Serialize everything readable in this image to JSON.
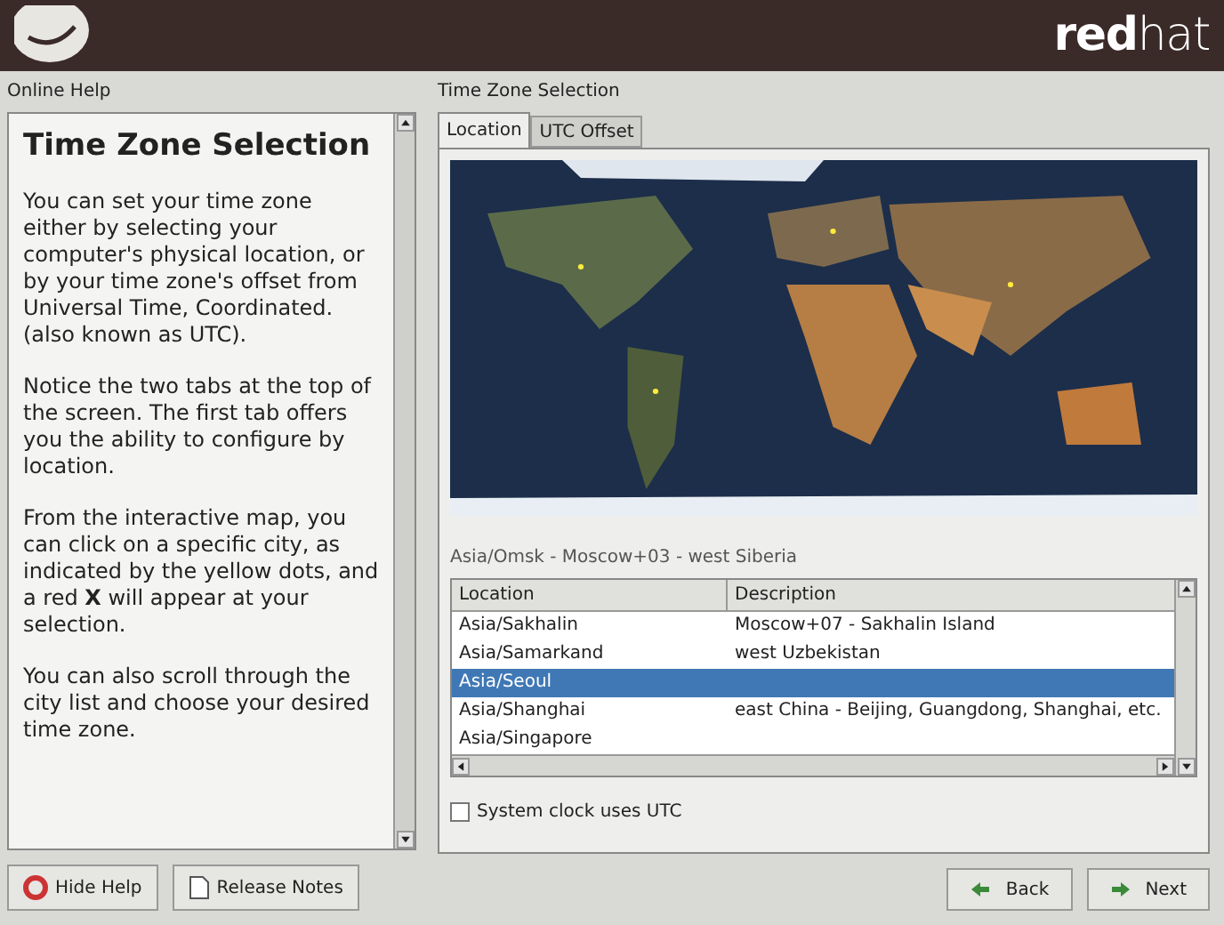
{
  "header": {
    "logo_bold": "red",
    "logo_light": "hat"
  },
  "help": {
    "title": "Online Help",
    "heading": "Time Zone Selection",
    "paragraphs": [
      "You can set your time zone either by selecting your computer's physical location, or by your time zone's offset from Universal Time, Coordinated. (also known as UTC).",
      "Notice the two tabs at the top of the screen. The first tab offers you the ability to configure by location.",
      "From the interactive map, you can click on a specific city, as indicated by the yellow dots, and a red **X** will appear at your selection.",
      "You can also scroll through the city list and choose your desired time zone."
    ]
  },
  "main": {
    "title": "Time Zone Selection",
    "tabs": [
      {
        "label": "Location",
        "selected": true
      },
      {
        "label": "UTC Offset",
        "selected": false
      }
    ],
    "status": "Asia/Omsk - Moscow+03 - west Siberia",
    "table": {
      "columns": [
        "Location",
        "Description"
      ],
      "rows": [
        {
          "location": "Asia/Sakhalin",
          "description": "Moscow+07 - Sakhalin Island",
          "selected": false
        },
        {
          "location": "Asia/Samarkand",
          "description": "west Uzbekistan",
          "selected": false
        },
        {
          "location": "Asia/Seoul",
          "selected": true
        },
        {
          "location": "Asia/Shanghai",
          "description": "east China - Beijing, Guangdong, Shanghai, etc.",
          "selected": false
        },
        {
          "location": "Asia/Singapore",
          "selected": false
        }
      ]
    },
    "utc_checkbox": {
      "label": "System clock uses UTC",
      "checked": false
    }
  },
  "buttons": {
    "hide_help": "Hide Help",
    "release_notes": "Release Notes",
    "back": "Back",
    "next": "Next"
  }
}
